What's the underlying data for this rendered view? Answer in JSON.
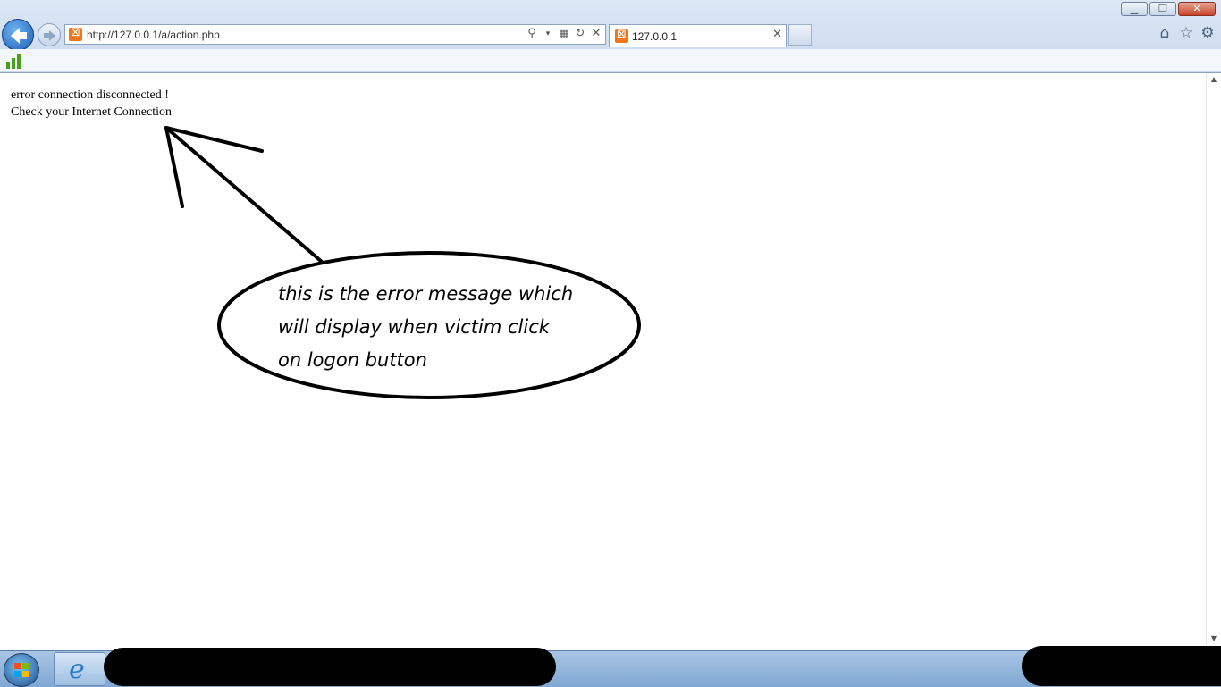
{
  "browser": {
    "address_url": "http://127.0.0.1/a/action.php",
    "tab_title": "127.0.0.1",
    "window_controls": [
      "minimize",
      "restore",
      "close"
    ]
  },
  "icons": {
    "back": "back-arrow-icon",
    "forward": "forward-arrow-icon",
    "address": [
      "search-icon",
      "dropdown-icon",
      "compat-view-icon",
      "refresh-icon",
      "stop-icon"
    ],
    "right": [
      "home-icon",
      "favorites-star-icon",
      "tools-gear-icon"
    ]
  },
  "page": {
    "line1": "error connection disconnected !",
    "line2": "Check your Internet Connection"
  },
  "annotation": {
    "line1": "this is the error message which",
    "line2": "will display when victim click",
    "line3": "on logon button"
  },
  "taskbar": {
    "pinned": [
      "start-button",
      "internet-explorer"
    ]
  }
}
